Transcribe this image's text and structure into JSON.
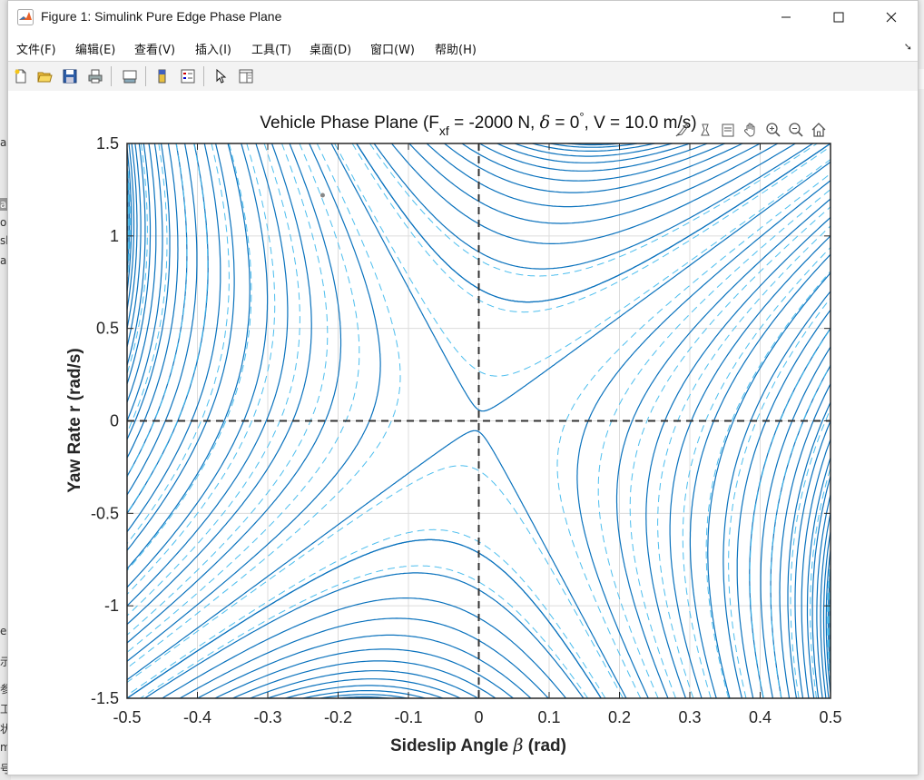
{
  "window": {
    "title": "Figure 1: Simulink Pure Edge Phase Plane"
  },
  "menu": [
    "文件(F)",
    "编辑(E)",
    "查看(V)",
    "插入(I)",
    "工具(T)",
    "桌面(D)",
    "窗口(W)",
    "帮助(H)"
  ],
  "toolbar_icons": [
    "new-figure-icon",
    "open-file-icon",
    "save-icon",
    "print-icon",
    "link-plot-icon",
    "colorbar-icon",
    "legend-icon",
    "pointer-icon",
    "property-editor-icon"
  ],
  "axes_toolbar_icons": [
    "brush-icon",
    "data-tips-icon",
    "restore-view-icon",
    "pan-icon",
    "zoom-in-icon",
    "zoom-out-icon",
    "home-icon"
  ],
  "chart_data": {
    "type": "line",
    "title_parts": {
      "prefix": "Vehicle Phase Plane (F",
      "subscript": "xf",
      "middle": " = -2000 N, ",
      "delta": "δ",
      "delta_value": " = 0",
      "degree": "°",
      "suffix": ", V = 10.0 m/s)"
    },
    "xlabel_parts": {
      "prefix": "Sideslip Angle ",
      "symbol": "β",
      "suffix": " (rad)"
    },
    "ylabel": "Yaw Rate r (rad/s)",
    "xlim": [
      -0.5,
      0.5
    ],
    "ylim": [
      -1.5,
      1.5
    ],
    "xticks": [
      "-0.5",
      "-0.4",
      "-0.3",
      "-0.2",
      "-0.1",
      "0",
      "0.1",
      "0.2",
      "0.3",
      "0.4",
      "0.5"
    ],
    "yticks": [
      "-1.5",
      "-1",
      "-0.5",
      "0",
      "0.5",
      "1",
      "1.5"
    ],
    "grid": true,
    "equilibrium": [
      0,
      0
    ],
    "stable_color": "#0a72bd",
    "unstable_color": "#4dbeee",
    "unstable_style": "dashed",
    "reference_lines": {
      "x": 0,
      "y": 0,
      "style": "dashed",
      "color": "#333333"
    },
    "marker_point": [
      -0.222,
      1.22
    ]
  },
  "background": {
    "left_fragments": [
      "ar",
      "ar",
      "oc",
      "sb",
      "ar",
      "e",
      "示",
      "参",
      "工",
      "状",
      "m",
      "号"
    ]
  },
  "colors": {
    "accent": "#0072bd",
    "window_bg": "#ffffff",
    "toolbar_bg": "#f3f3f3"
  }
}
